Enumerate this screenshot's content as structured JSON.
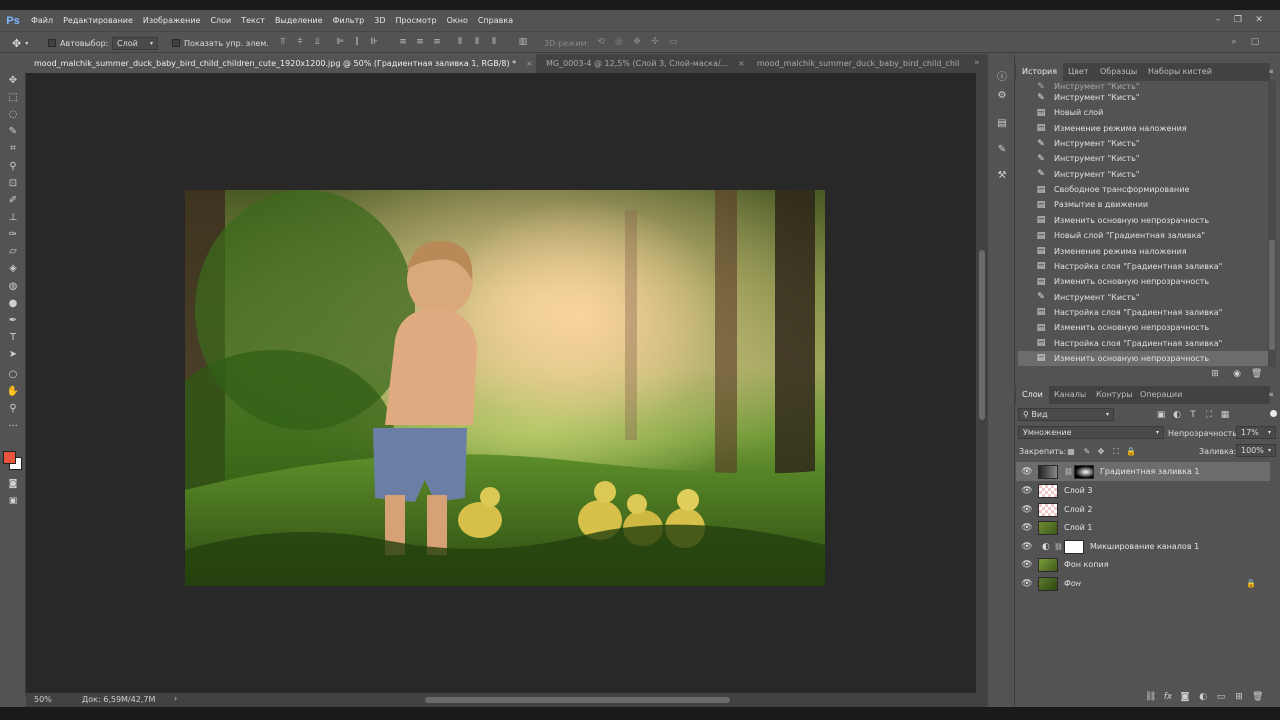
{
  "app": {
    "logo": "Ps"
  },
  "menubar": {
    "items": [
      "Файл",
      "Редактирование",
      "Изображение",
      "Слои",
      "Текст",
      "Выделение",
      "Фильтр",
      "3D",
      "Просмотр",
      "Окно",
      "Справка"
    ],
    "minimize": "–",
    "restore": "❐",
    "close": "✕"
  },
  "options": {
    "autoselect_label": "Автовыбор:",
    "autoselect_value": "Слой",
    "show_controls_label": "Показать упр. элем.",
    "mode3d_label": "3D-режим:"
  },
  "tabs": [
    {
      "label": "mood_malchik_summer_duck_baby_bird_child_children_cute_1920x1200.jpg @ 50% (Градиентная заливка 1, RGB/8) *",
      "close": "×",
      "active": true
    },
    {
      "label": "MG_0003-4 @ 12,5% (Слой 3, Слой-маска/...",
      "close": "×",
      "active": false
    },
    {
      "label": "mood_malchik_summer_duck_baby_bird_child_chil",
      "close": "",
      "active": false
    }
  ],
  "status": {
    "zoom": "50%",
    "doc": "Док: 6,59M/42,7M",
    "arrow": "›"
  },
  "history_panel": {
    "tabs": [
      "История",
      "Цвет",
      "Образцы",
      "Наборы кистей"
    ],
    "items": [
      {
        "icon": "brush-icon",
        "label": "Инструмент \"Кисть\""
      },
      {
        "icon": "doc-icon",
        "label": "Новый слой"
      },
      {
        "icon": "doc-icon",
        "label": "Изменение режима наложения"
      },
      {
        "icon": "brush-icon",
        "label": "Инструмент \"Кисть\""
      },
      {
        "icon": "brush-icon",
        "label": "Инструмент \"Кисть\""
      },
      {
        "icon": "brush-icon",
        "label": "Инструмент \"Кисть\""
      },
      {
        "icon": "doc-icon",
        "label": "Свободное трансформирование"
      },
      {
        "icon": "doc-icon",
        "label": "Размытие в движении"
      },
      {
        "icon": "doc-icon",
        "label": "Изменить основную непрозрачность"
      },
      {
        "icon": "doc-icon",
        "label": "Новый слой \"Градиентная заливка\""
      },
      {
        "icon": "doc-icon",
        "label": "Изменение режима наложения"
      },
      {
        "icon": "doc-icon",
        "label": "Настройка слоя \"Градиентная заливка\""
      },
      {
        "icon": "doc-icon",
        "label": "Изменить основную непрозрачность"
      },
      {
        "icon": "brush-icon",
        "label": "Инструмент \"Кисть\""
      },
      {
        "icon": "doc-icon",
        "label": "Настройка слоя \"Градиентная заливка\""
      },
      {
        "icon": "doc-icon",
        "label": "Изменить основную непрозрачность"
      },
      {
        "icon": "doc-icon",
        "label": "Настройка слоя \"Градиентная заливка\""
      },
      {
        "icon": "doc-icon",
        "label": "Изменить основную непрозрачность"
      }
    ]
  },
  "layers_panel": {
    "tabs": [
      "Слои",
      "Каналы",
      "Контуры",
      "Операции"
    ],
    "filter": "Вид",
    "blend_mode": "Умножение",
    "opacity_label": "Непрозрачность:",
    "opacity_value": "17%",
    "lock_label": "Закрепить:",
    "fill_label": "Заливка:",
    "fill_value": "100%",
    "layers": [
      {
        "name": "Градиентная заливка 1",
        "selected": true
      },
      {
        "name": "Слой 3",
        "selected": false
      },
      {
        "name": "Слой 2",
        "selected": false
      },
      {
        "name": "Слой 1",
        "selected": false
      },
      {
        "name": "Микширование каналов 1",
        "selected": false
      },
      {
        "name": "Фон копия",
        "selected": false
      },
      {
        "name": "Фон",
        "selected": false
      }
    ]
  },
  "colors": {
    "foreground": "#e8553b",
    "background": "#ffffff",
    "accent": "#7fb6ff"
  }
}
